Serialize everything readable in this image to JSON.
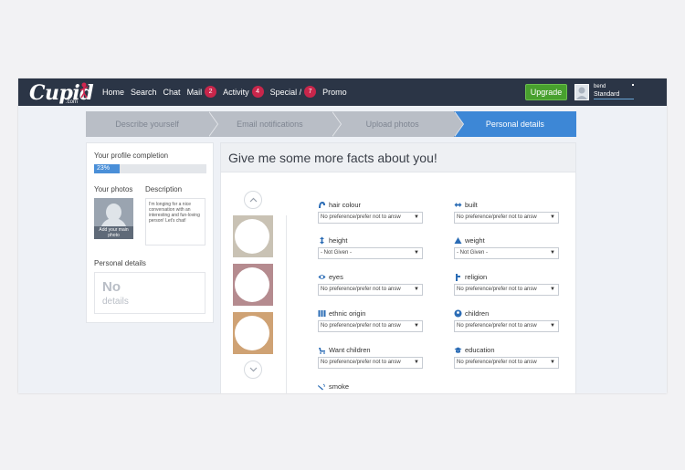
{
  "nav": {
    "logo_text": "Cupid",
    "logo_suffix": ".com",
    "links": [
      {
        "label": "Home",
        "badge": ""
      },
      {
        "label": "Search",
        "badge": ""
      },
      {
        "label": "Chat",
        "badge": ""
      },
      {
        "label": "Mail",
        "badge": "2"
      },
      {
        "label": "Activity",
        "badge": "4"
      },
      {
        "label": "Special /",
        "badge": "7"
      },
      {
        "label": "Promo",
        "badge": ""
      }
    ],
    "upgrade_label": "Upgrade",
    "user_name": "bend",
    "user_level": "Standard"
  },
  "steps": [
    "Describe yourself",
    "Email notifications",
    "Upload photos",
    "Personal details"
  ],
  "active_step": 3,
  "sidebar": {
    "profile_completion_label": "Your profile completion",
    "profile_completion_value": "23%",
    "photos_label": "Your photos",
    "description_label": "Description",
    "add_photo_label": "Add your main photo",
    "description_text": "I'm longing for a nice conversation with an interesting and fun-loving person! Let's chat!",
    "personal_details_label": "Personal details",
    "no_details_big": "No",
    "no_details_small": "details"
  },
  "main": {
    "title": "Give me some more facts about you!",
    "fields": [
      {
        "label": "hair colour",
        "value": "No preference/prefer not to answ",
        "icon": "hair-icon"
      },
      {
        "label": "built",
        "value": "No preference/prefer not to answ",
        "icon": "built-icon"
      },
      {
        "label": "height",
        "value": "- Not Given -",
        "icon": "height-icon"
      },
      {
        "label": "weight",
        "value": "- Not Given -",
        "icon": "weight-icon"
      },
      {
        "label": "eyes",
        "value": "No preference/prefer not to answ",
        "icon": "eye-icon"
      },
      {
        "label": "religion",
        "value": "No preference/prefer not to answ",
        "icon": "religion-icon"
      },
      {
        "label": "ethnic origin",
        "value": "No preference/prefer not to answ",
        "icon": "ethnic-icon"
      },
      {
        "label": "children",
        "value": "No preference/prefer not to answ",
        "icon": "children-icon"
      },
      {
        "label": "Want children",
        "value": "No preference/prefer not to answ",
        "icon": "want-children-icon"
      },
      {
        "label": "education",
        "value": "No preference/prefer not to answ",
        "icon": "education-icon"
      },
      {
        "label": "smoke",
        "value": "",
        "icon": "smoke-icon"
      }
    ]
  },
  "colors": {
    "nav_bg": "#2b3546",
    "accent_blue": "#3d87d6",
    "upgrade_green": "#48a02e",
    "badge_red": "#c8264b"
  }
}
